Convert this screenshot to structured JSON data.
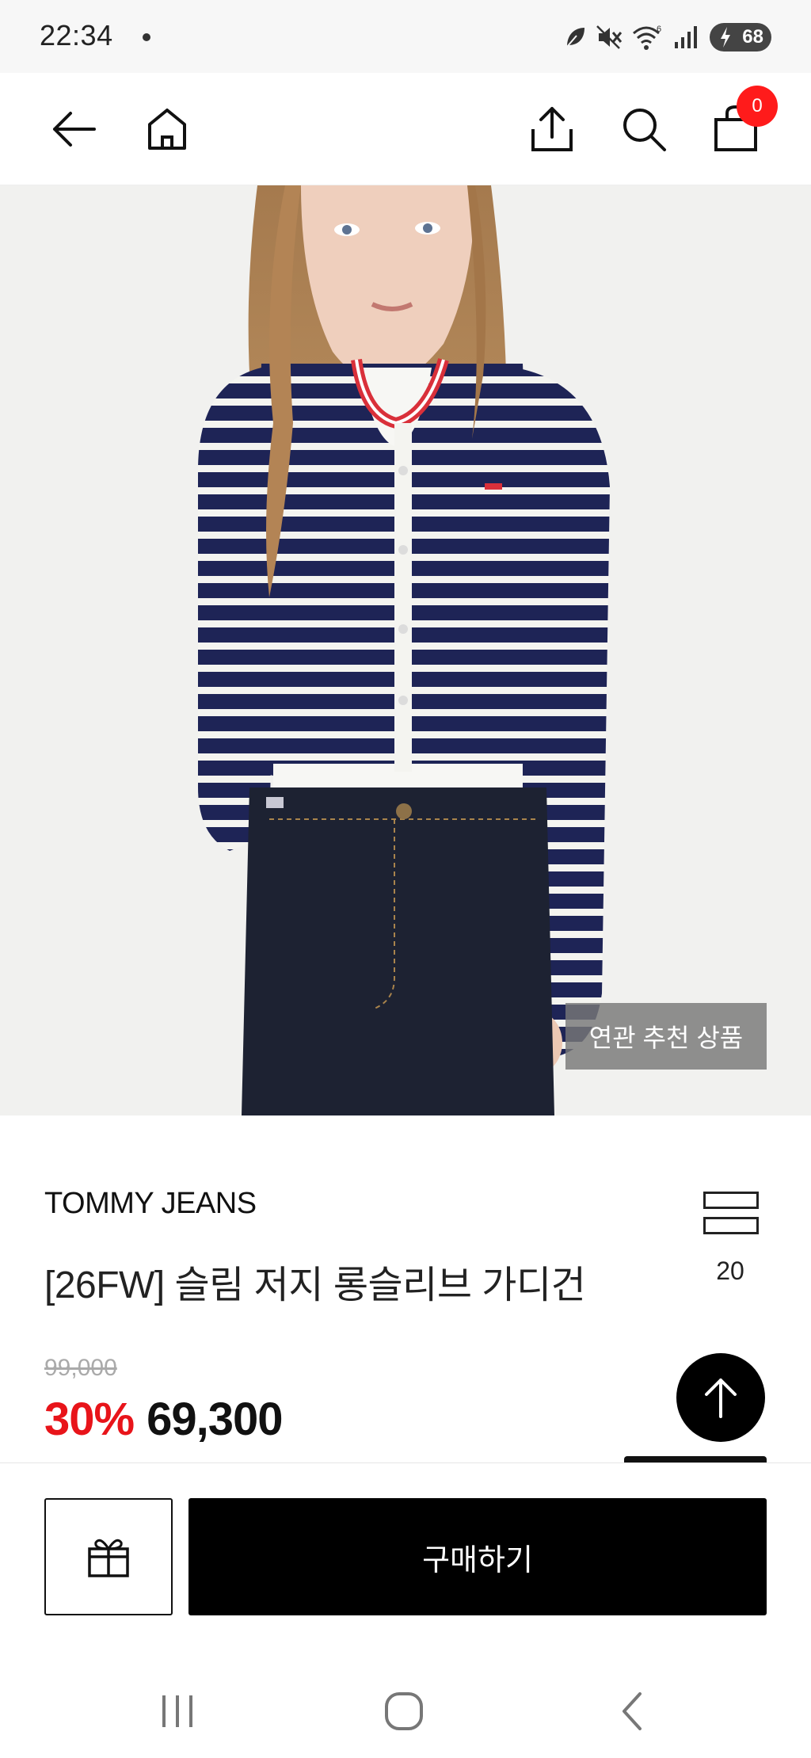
{
  "status_bar": {
    "time": "22:34",
    "battery": "68",
    "icons": [
      "leaf-icon",
      "mute-icon",
      "wifi-icon",
      "signal-icon",
      "battery-icon"
    ]
  },
  "top_nav": {
    "icons": [
      "back-arrow-icon",
      "home-icon",
      "share-icon",
      "search-icon",
      "shopping-bag-icon"
    ],
    "cart_count": "0"
  },
  "hero": {
    "related_button_label": "연관 추천 상품",
    "carousel_progress": 0.2
  },
  "product": {
    "brand": "TOMMY JEANS",
    "title": "[26FW] 슬림 저지 롱슬리브 가디건",
    "view_count": "20",
    "original_price": "99,000",
    "discount": "30%",
    "sale_price": "69,300"
  },
  "bottom_bar": {
    "buy_label": "구매하기",
    "gift_icon": "gift-icon"
  },
  "system_nav": {
    "icons": [
      "recent-apps-icon",
      "home-circle-icon",
      "back-chevron-icon"
    ]
  },
  "colors": {
    "discount_red": "#e8141a",
    "badge_red": "#ff1b1b",
    "navy_stripe": "#1e2456",
    "collar_red": "#d9303a"
  }
}
